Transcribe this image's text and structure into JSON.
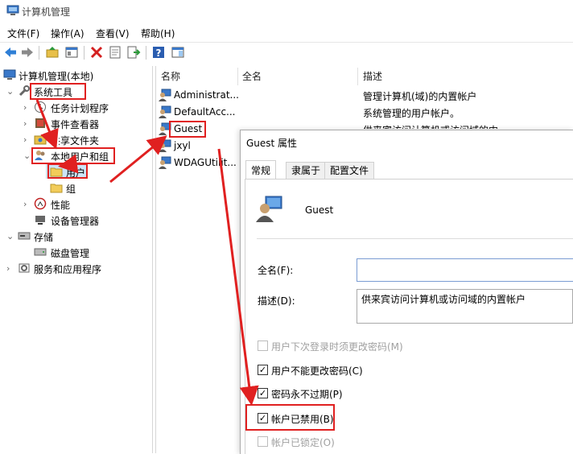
{
  "window": {
    "title": "计算机管理"
  },
  "menu": [
    "文件(F)",
    "操作(A)",
    "查看(V)",
    "帮助(H)"
  ],
  "tree": {
    "root": "计算机管理(本地)",
    "system_tools": "系统工具",
    "task_scheduler": "任务计划程序",
    "event_viewer": "事件查看器",
    "shared_folders": "共享文件夹",
    "local_users_groups": "本地用户和组",
    "users": "用户",
    "groups": "组",
    "performance": "性能",
    "device_manager": "设备管理器",
    "storage": "存储",
    "disk_management": "磁盘管理",
    "services_apps": "服务和应用程序"
  },
  "list": {
    "columns": [
      "名称",
      "全名",
      "描述"
    ],
    "rows": [
      {
        "name": "Administrat...",
        "fullname": "",
        "desc": "管理计算机(域)的内置帐户"
      },
      {
        "name": "DefaultAcc...",
        "fullname": "",
        "desc": "系统管理的用户帐户。"
      },
      {
        "name": "Guest",
        "fullname": "",
        "desc": "供来宾访问计算机或访问域的内..."
      },
      {
        "name": "jxyl",
        "fullname": "",
        "desc": ""
      },
      {
        "name": "WDAGUtilit...",
        "fullname": "",
        "desc": ""
      }
    ]
  },
  "dialog": {
    "title": "Guest 属性",
    "tabs": [
      "常规",
      "隶属于",
      "配置文件"
    ],
    "username": "Guest",
    "fullname_label": "全名(F):",
    "fullname_value": "",
    "desc_label": "描述(D):",
    "desc_value": "供来宾访问计算机或访问域的内置帐户",
    "checkboxes": [
      {
        "label": "用户下次登录时须更改密码(M)",
        "checked": false,
        "disabled": true
      },
      {
        "label": "用户不能更改密码(C)",
        "checked": true,
        "disabled": false
      },
      {
        "label": "密码永不过期(P)",
        "checked": true,
        "disabled": false
      },
      {
        "label": "帐户已禁用(B)",
        "checked": true,
        "disabled": false
      },
      {
        "label": "帐户已锁定(O)",
        "checked": false,
        "disabled": true
      }
    ]
  },
  "colors": {
    "annotation_red": "#e02020",
    "selection": "#cce4f7"
  }
}
